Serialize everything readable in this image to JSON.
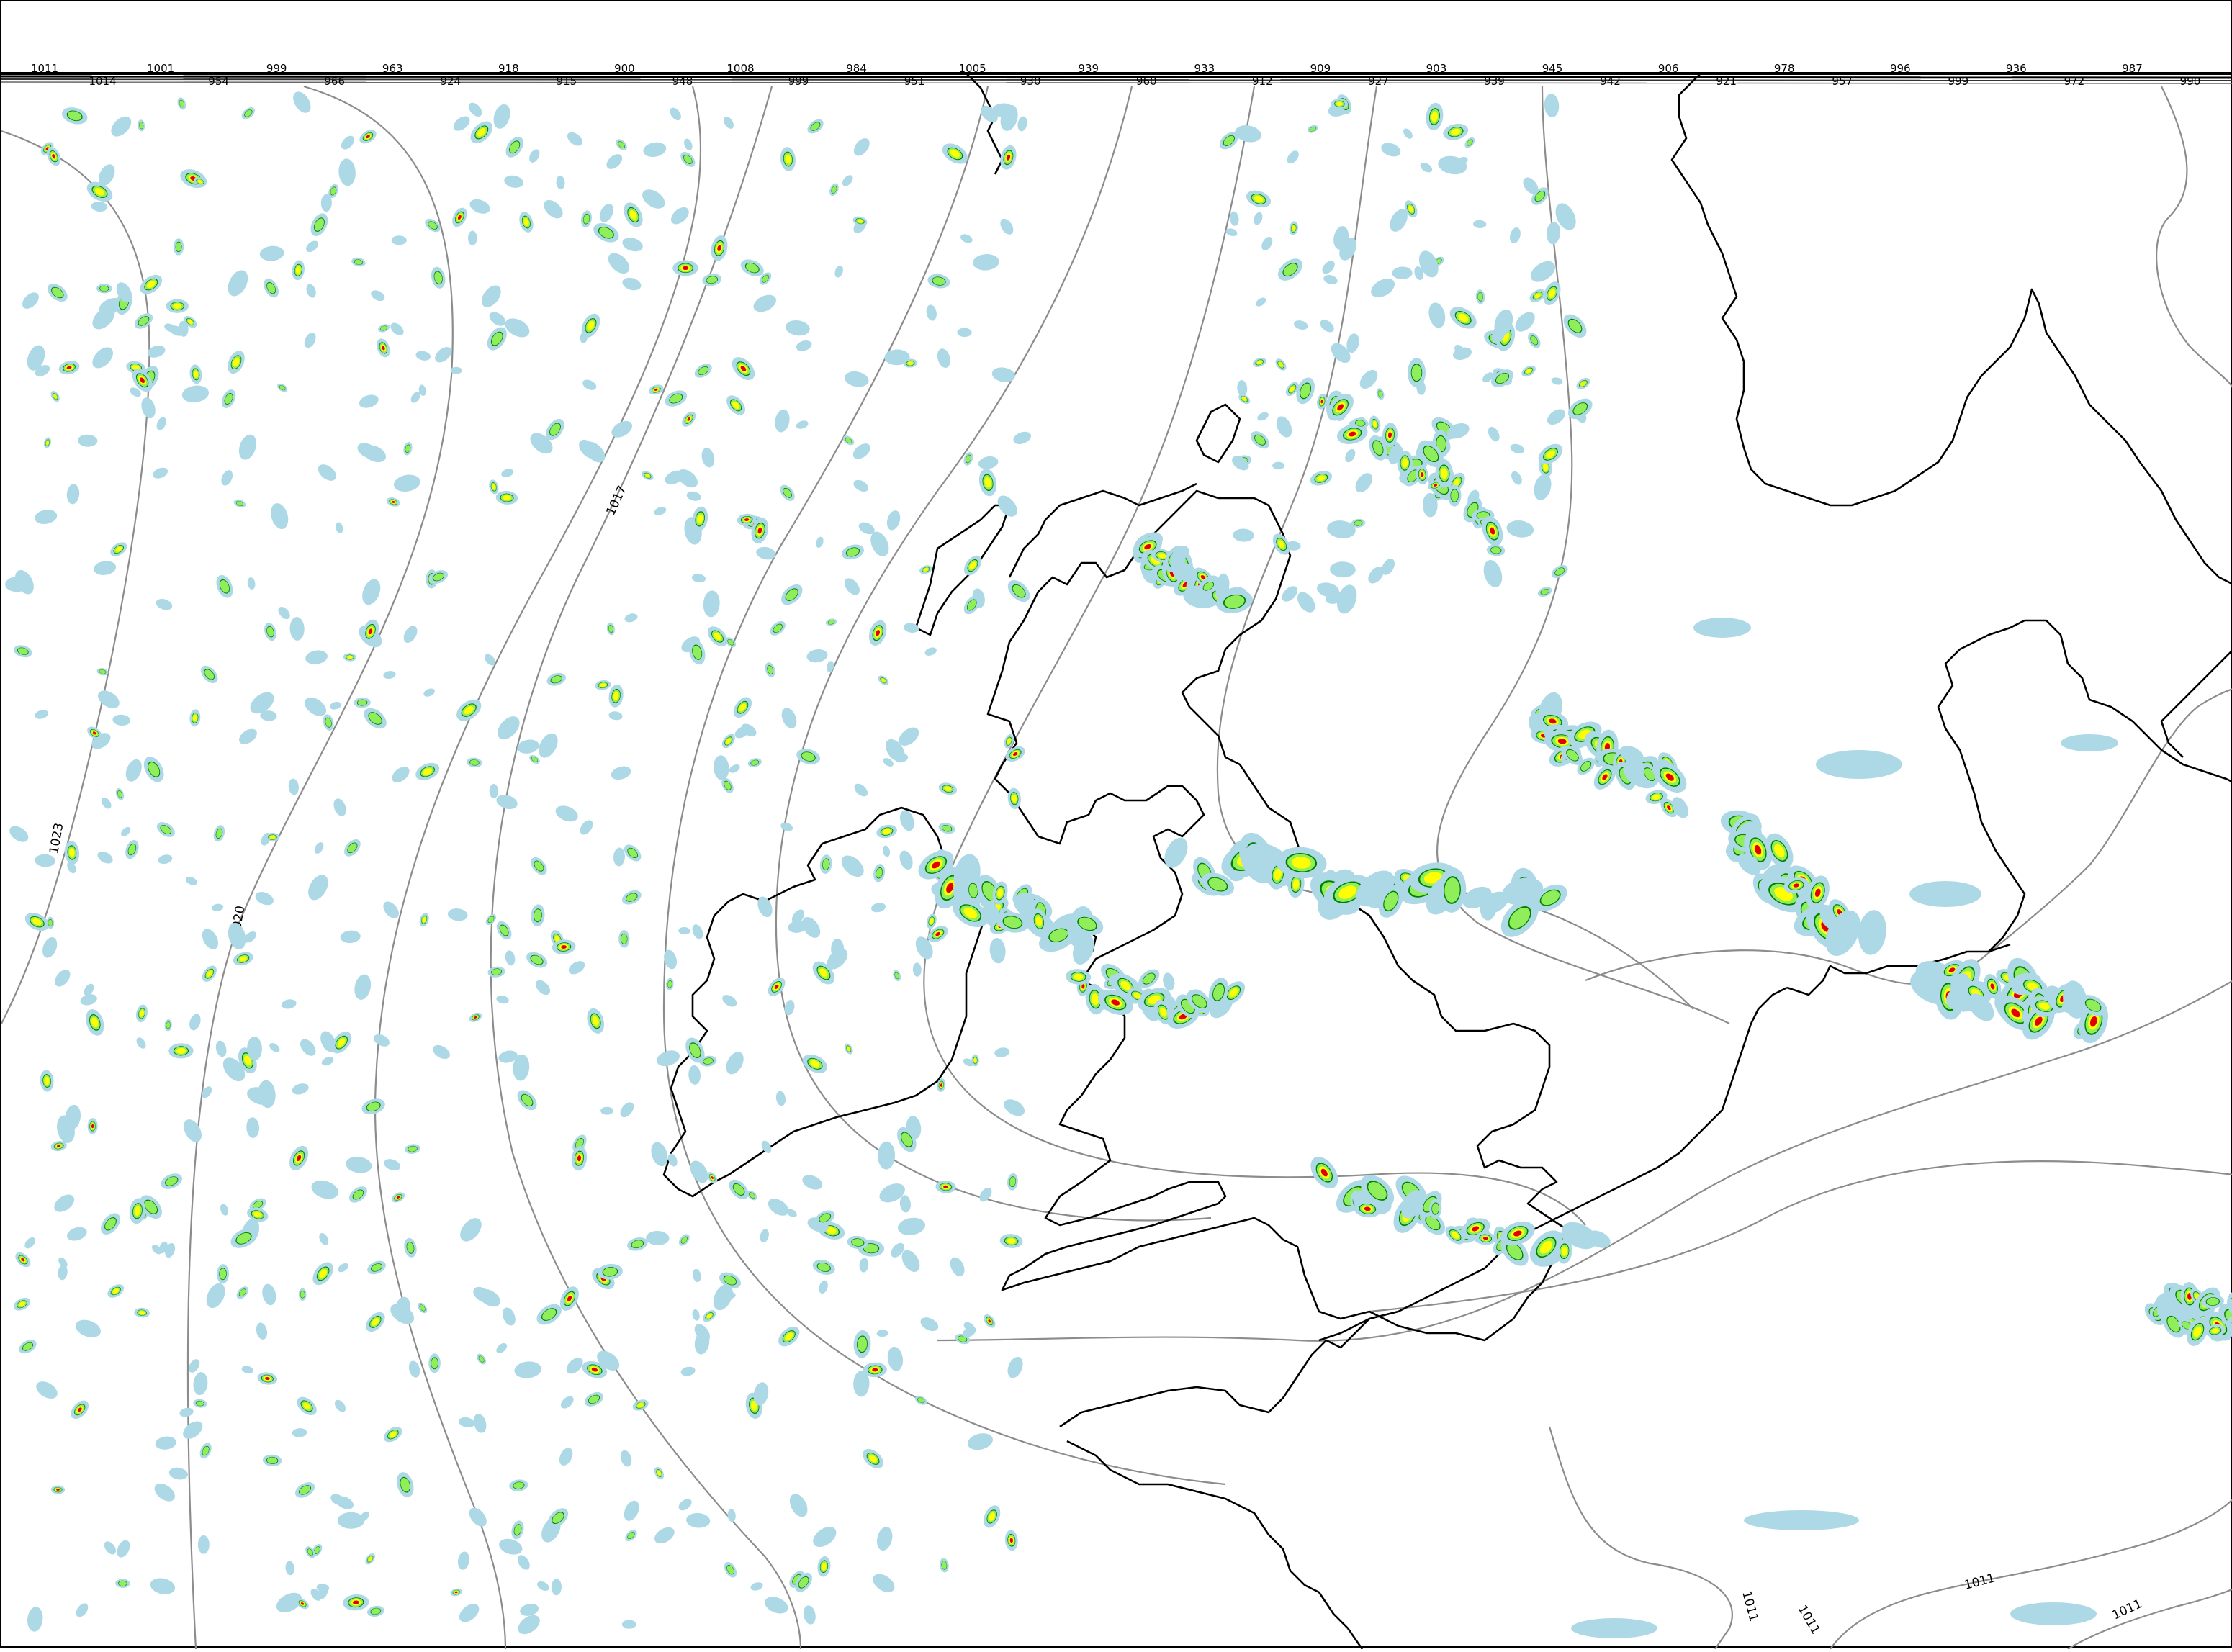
{
  "colors": {
    "background": "#ffffff",
    "isobar": "#8c8c8c",
    "coastline": "#000000",
    "precip_light": "#add8e6",
    "precip_moderate": "#90ee5a",
    "precip_heavy": "#ffff00",
    "precip_very_heavy": "#e00000",
    "precip_contour_green": "#008000"
  },
  "isobar_labels": [
    {
      "text": "1017",
      "rotation": -65
    },
    {
      "text": "1023",
      "rotation": -80
    },
    {
      "text": "1020",
      "rotation": -80
    },
    {
      "text": "1011",
      "rotation": 75
    },
    {
      "text": "1011",
      "rotation": 60
    },
    {
      "text": "1011",
      "rotation": -15
    },
    {
      "text": "1011",
      "rotation": -25
    }
  ],
  "top_edge_labels": [
    "1011",
    "1014",
    "1001",
    "954",
    "999",
    "966",
    "963",
    "924",
    "918",
    "915",
    "900",
    "948",
    "1008",
    "999",
    "984",
    "951",
    "1005",
    "930",
    "939",
    "960",
    "933",
    "912",
    "909",
    "927",
    "903",
    "939",
    "945",
    "942",
    "906",
    "921",
    "978",
    "957",
    "996",
    "999",
    "936",
    "972",
    "987",
    "990"
  ]
}
